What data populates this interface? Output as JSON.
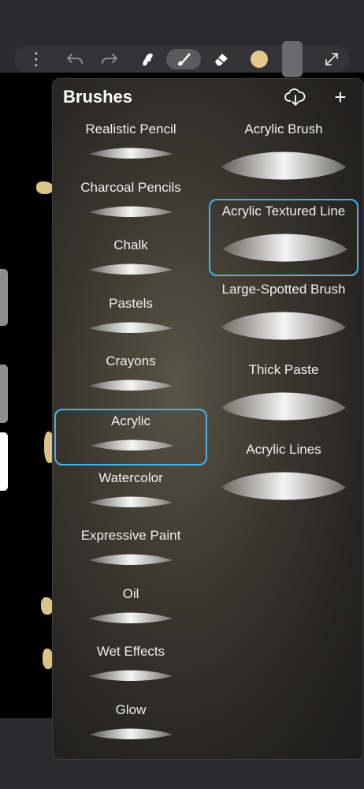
{
  "toolbar": {
    "items": [
      {
        "name": "more-menu",
        "icon": "ellipsis-icon"
      },
      {
        "name": "undo",
        "icon": "undo-icon"
      },
      {
        "name": "redo",
        "icon": "redo-icon"
      },
      {
        "name": "smudge",
        "icon": "smudge-icon"
      },
      {
        "name": "brush",
        "icon": "brush-icon",
        "active": true
      },
      {
        "name": "eraser",
        "icon": "eraser-icon"
      },
      {
        "name": "color",
        "icon": "color-swatch",
        "color": "#e3c98d"
      },
      {
        "name": "layers",
        "icon": "layers-icon"
      },
      {
        "name": "fullscreen",
        "icon": "expand-icon"
      }
    ]
  },
  "panel": {
    "title": "Brushes",
    "cloud_icon": "cloud-download-icon",
    "add_icon": "plus-icon",
    "add_label": "+",
    "left_column": [
      {
        "label": "Realistic Pencil",
        "selected": false
      },
      {
        "label": "Charcoal Pencils",
        "selected": false
      },
      {
        "label": "Chalk",
        "selected": false
      },
      {
        "label": "Pastels",
        "selected": false
      },
      {
        "label": "Crayons",
        "selected": false
      },
      {
        "label": "Acrylic",
        "selected": true
      },
      {
        "label": "Watercolor",
        "selected": false
      },
      {
        "label": "Expressive Paint",
        "selected": false
      },
      {
        "label": "Oil",
        "selected": false
      },
      {
        "label": "Wet Effects",
        "selected": false
      },
      {
        "label": "Glow",
        "selected": false
      }
    ],
    "right_column": [
      {
        "label": "Acrylic Brush",
        "selected": false
      },
      {
        "label": "Acrylic Textured Line",
        "selected": true
      },
      {
        "label": "Large-Spotted Brush",
        "selected": false
      },
      {
        "label": "Thick Paste",
        "selected": false
      },
      {
        "label": "Acrylic Lines",
        "selected": false
      }
    ]
  },
  "colors": {
    "selection_border": "#4cb0e8",
    "current_color": "#e3c98d"
  }
}
